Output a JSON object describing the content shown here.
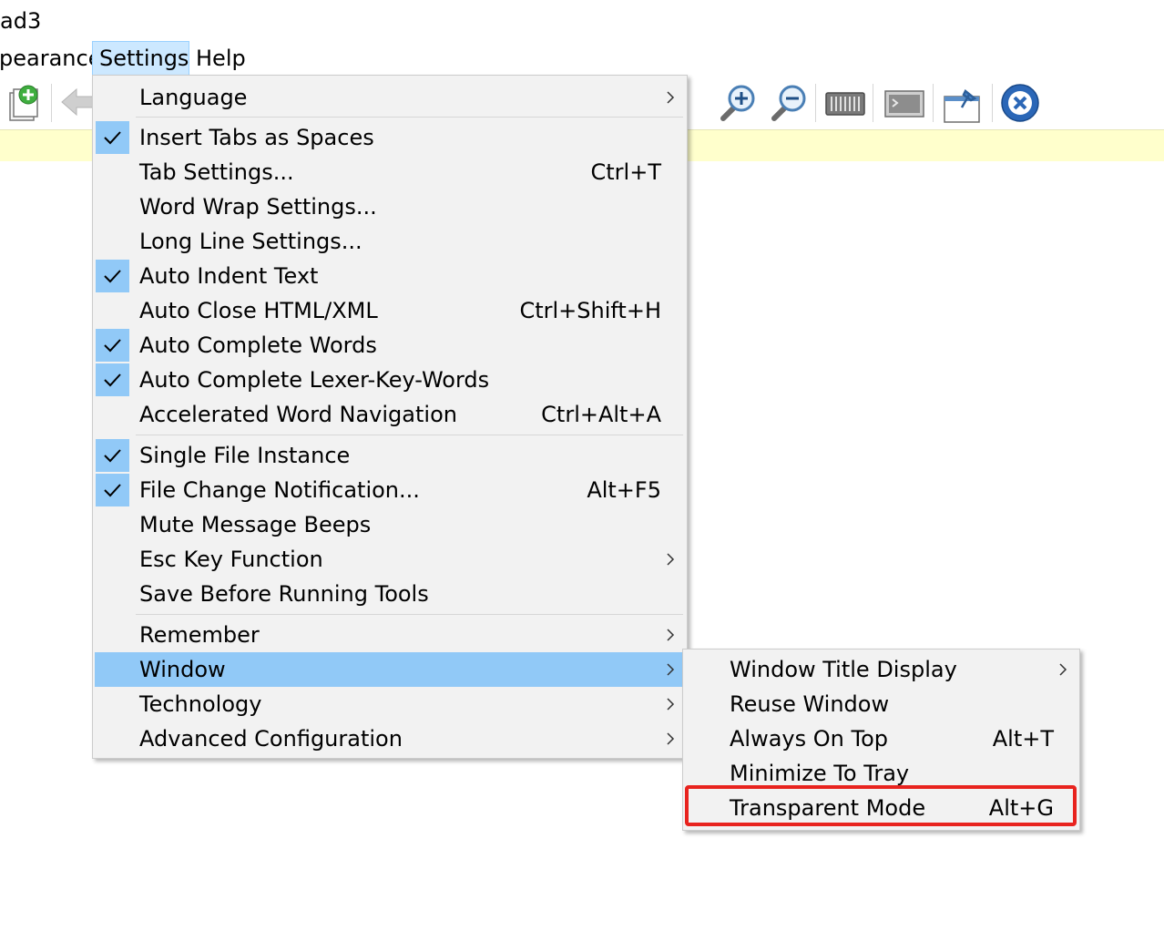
{
  "window_title": "ad3",
  "menubar": {
    "appearance": "pearance",
    "settings": "Settings",
    "help": "Help"
  },
  "toolbar": {
    "buttons": [
      "add-file-icon",
      "back-arrow-icon",
      "zoom-in-icon",
      "zoom-out-icon",
      "keyboard-icon",
      "terminal-icon",
      "pin-icon",
      "close-circle-icon"
    ]
  },
  "colors": {
    "highlight": "#91c9f7",
    "menu_bg": "#f2f2f2",
    "infobar": "#ffffcc",
    "annotation_red": "#e8231e"
  },
  "settings_menu": {
    "items": [
      {
        "label": "Language",
        "shortcut": "",
        "checked": false,
        "submenu": true
      },
      {
        "label": "Insert Tabs as Spaces",
        "shortcut": "",
        "checked": true,
        "submenu": false
      },
      {
        "label": "Tab Settings...",
        "shortcut": "Ctrl+T",
        "checked": false,
        "submenu": false
      },
      {
        "label": "Word Wrap Settings...",
        "shortcut": "",
        "checked": false,
        "submenu": false
      },
      {
        "label": "Long Line Settings...",
        "shortcut": "",
        "checked": false,
        "submenu": false
      },
      {
        "label": "Auto Indent Text",
        "shortcut": "",
        "checked": true,
        "submenu": false
      },
      {
        "label": "Auto Close HTML/XML",
        "shortcut": "Ctrl+Shift+H",
        "checked": false,
        "submenu": false
      },
      {
        "label": "Auto Complete Words",
        "shortcut": "",
        "checked": true,
        "submenu": false
      },
      {
        "label": "Auto Complete Lexer-Key-Words",
        "shortcut": "",
        "checked": true,
        "submenu": false
      },
      {
        "label": "Accelerated Word Navigation",
        "shortcut": "Ctrl+Alt+A",
        "checked": false,
        "submenu": false
      },
      {
        "label": "Single File Instance",
        "shortcut": "",
        "checked": true,
        "submenu": false
      },
      {
        "label": "File Change Notification...",
        "shortcut": "Alt+F5",
        "checked": true,
        "submenu": false
      },
      {
        "label": "Mute Message Beeps",
        "shortcut": "",
        "checked": false,
        "submenu": false
      },
      {
        "label": "Esc Key Function",
        "shortcut": "",
        "checked": false,
        "submenu": true
      },
      {
        "label": "Save Before Running Tools",
        "shortcut": "",
        "checked": false,
        "submenu": false
      },
      {
        "label": "Remember",
        "shortcut": "",
        "checked": false,
        "submenu": true
      },
      {
        "label": "Window",
        "shortcut": "",
        "checked": false,
        "submenu": true,
        "highlighted": true
      },
      {
        "label": "Technology",
        "shortcut": "",
        "checked": false,
        "submenu": true
      },
      {
        "label": "Advanced Configuration",
        "shortcut": "",
        "checked": false,
        "submenu": true
      }
    ]
  },
  "window_submenu": {
    "items": [
      {
        "label": "Window Title Display",
        "shortcut": "",
        "submenu": true
      },
      {
        "label": "Reuse Window",
        "shortcut": "",
        "submenu": false
      },
      {
        "label": "Always On Top",
        "shortcut": "Alt+T",
        "submenu": false
      },
      {
        "label": "Minimize To Tray",
        "shortcut": "",
        "submenu": false
      },
      {
        "label": "Transparent Mode",
        "shortcut": "Alt+G",
        "submenu": false,
        "annotated": true
      }
    ]
  }
}
